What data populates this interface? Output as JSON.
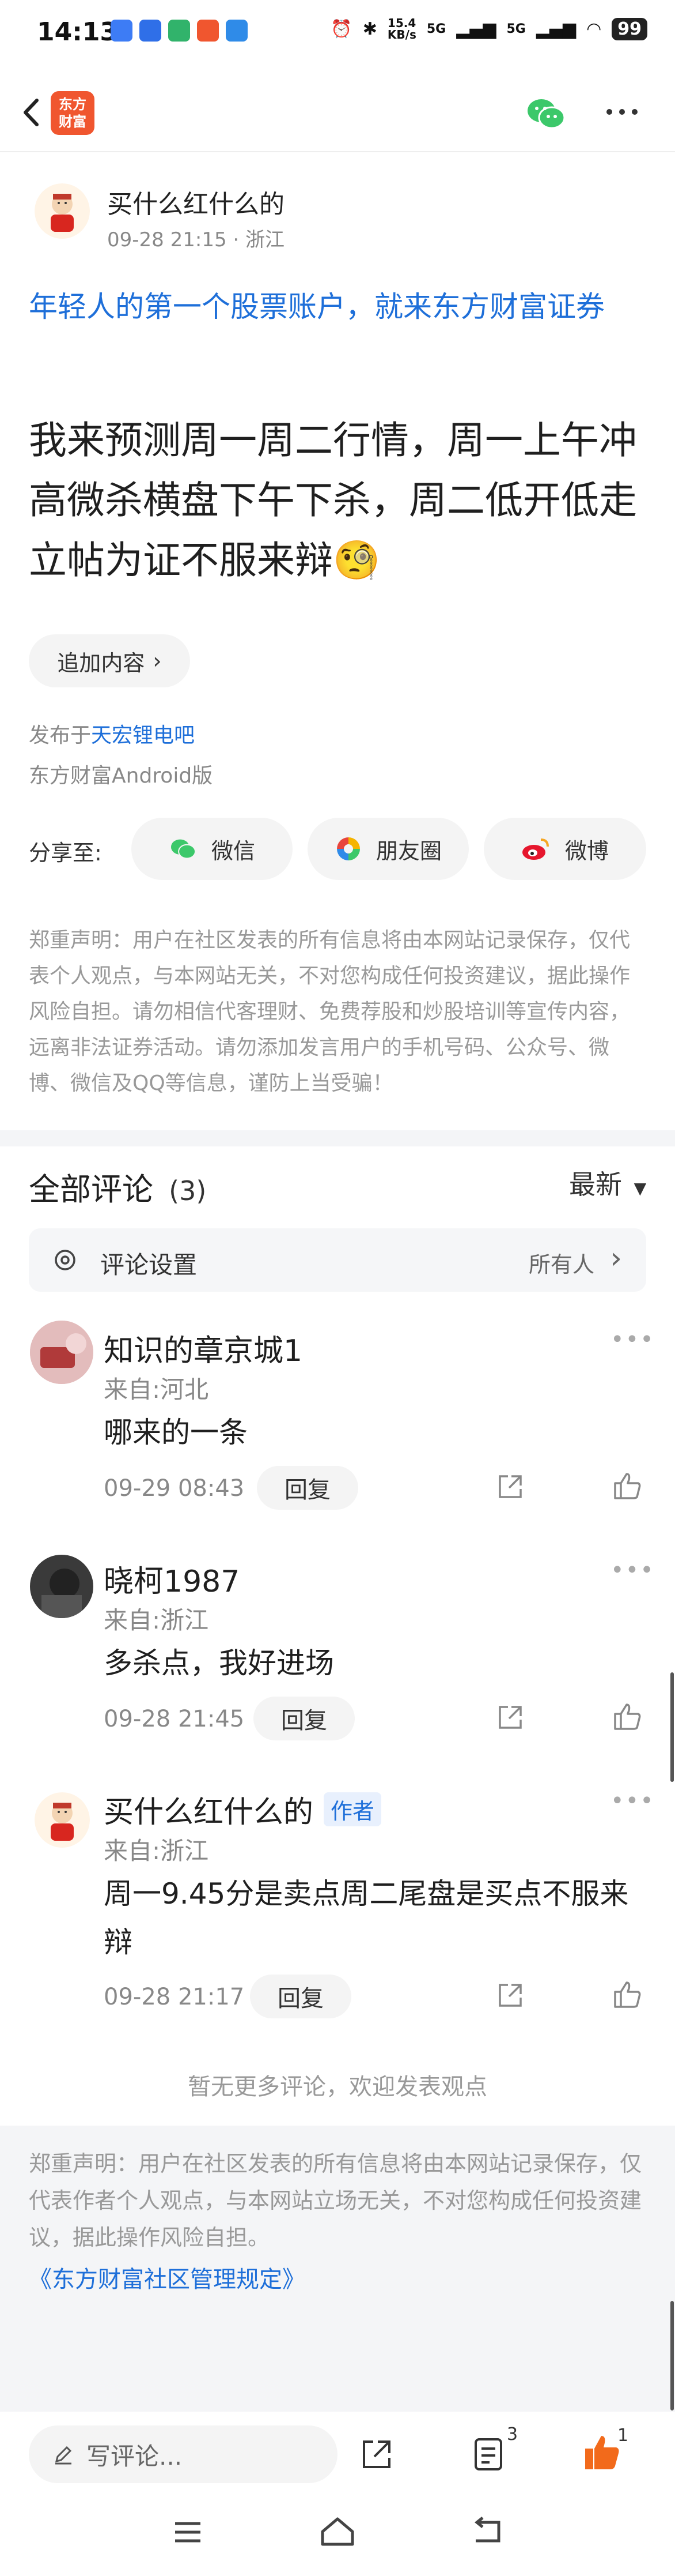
{
  "status_bar": {
    "time": "14:13",
    "speed": "15.4\nKB/s",
    "net1": "5G",
    "net2": "5G",
    "battery": "99"
  },
  "nav": {
    "logo_text_line1": "东方",
    "logo_text_line2": "财富"
  },
  "post": {
    "author": "买什么红什么的",
    "meta": "09-28 21:15 · 浙江",
    "ad_text": "年轻人的第一个股票账户，就来东方财富证券",
    "content": "我来预测周一周二行情，周一上午冲高微杀横盘下午下杀，周二低开低走立帖为证不服来辩",
    "add_content_label": "追加内容",
    "published_prefix": "发布于",
    "bar_name": "天宏锂电吧",
    "client": "东方财富Android版",
    "share_label": "分享至:",
    "share_buttons": [
      "微信",
      "朋友圈",
      "微博"
    ],
    "disclaimer": "郑重声明：用户在社区发表的所有信息将由本网站记录保存，仅代表个人观点，与本网站无关，不对您构成任何投资建议，据此操作风险自担。请勿相信代客理财、免费荐股和炒股培训等宣传内容，远离非法证券活动。请勿添加发言用户的手机号码、公众号、微博、微信及QQ等信息，谨防上当受骗！"
  },
  "comments_section": {
    "title": "全部评论",
    "count": "(3)",
    "sort": "最新",
    "settings_label": "评论设置",
    "settings_value": "所有人",
    "reply_label": "回复",
    "items": [
      {
        "name": "知识的章京城1",
        "from": "来自:河北",
        "text": "哪来的一条",
        "date": "09-29 08:43"
      },
      {
        "name": "晓柯1987",
        "from": "来自:浙江",
        "text": "多杀点，我好进场",
        "date": "09-28 21:45"
      },
      {
        "name": "买什么红什么的",
        "tag": "作者",
        "from": "来自:浙江",
        "text": "周一9.45分是卖点周二尾盘是买点不服来辩",
        "date": "09-28 21:17"
      }
    ],
    "no_more": "暂无更多评论，欢迎发表观点"
  },
  "footer": {
    "disclaimer": "郑重声明：用户在社区发表的所有信息将由本网站记录保存，仅代表作者个人观点，与本网站立场无关，不对您构成任何投资建议，据此操作风险自担。",
    "rule_link": "《东方财富社区管理规定》"
  },
  "bottom_bar": {
    "comment_placeholder": "写评论...",
    "comment_count_badge": "3",
    "like_count_badge": "1"
  },
  "colors": {
    "accent_blue": "#1e6fd9",
    "brand_orange": "#f0562f",
    "like_orange": "#f26a1b"
  }
}
